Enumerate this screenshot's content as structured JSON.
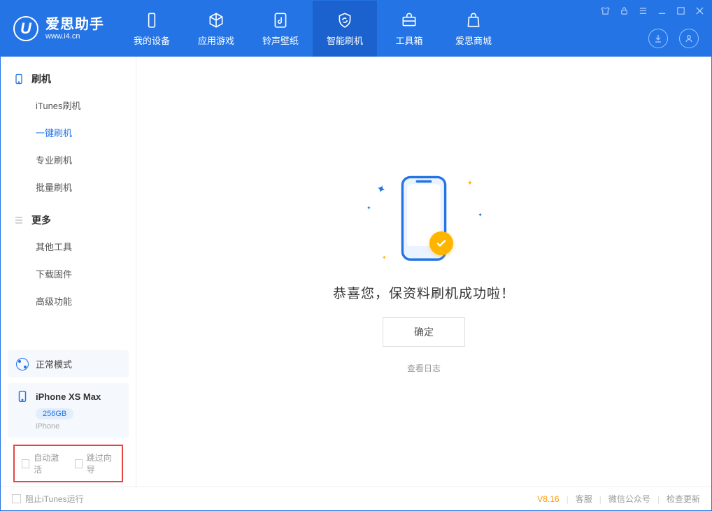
{
  "app": {
    "title": "爱思助手",
    "subtitle": "www.i4.cn"
  },
  "tabs": [
    {
      "label": "我的设备"
    },
    {
      "label": "应用游戏"
    },
    {
      "label": "铃声壁纸"
    },
    {
      "label": "智能刷机"
    },
    {
      "label": "工具箱"
    },
    {
      "label": "爱思商城"
    }
  ],
  "sidebar": {
    "group1": {
      "title": "刷机"
    },
    "items1": [
      {
        "label": "iTunes刷机"
      },
      {
        "label": "一键刷机"
      },
      {
        "label": "专业刷机"
      },
      {
        "label": "批量刷机"
      }
    ],
    "group2": {
      "title": "更多"
    },
    "items2": [
      {
        "label": "其他工具"
      },
      {
        "label": "下载固件"
      },
      {
        "label": "高级功能"
      }
    ],
    "mode": "正常模式",
    "device": {
      "name": "iPhone XS Max",
      "storage": "256GB",
      "type": "iPhone"
    },
    "checkboxes": {
      "auto_activate": "自动激活",
      "skip_guide": "跳过向导"
    }
  },
  "main": {
    "success_text": "恭喜您，保资料刷机成功啦！",
    "ok_button": "确定",
    "log_link": "查看日志"
  },
  "footer": {
    "block_itunes": "阻止iTunes运行",
    "version": "V8.16",
    "links": {
      "service": "客服",
      "wechat": "微信公众号",
      "update": "检查更新"
    }
  }
}
